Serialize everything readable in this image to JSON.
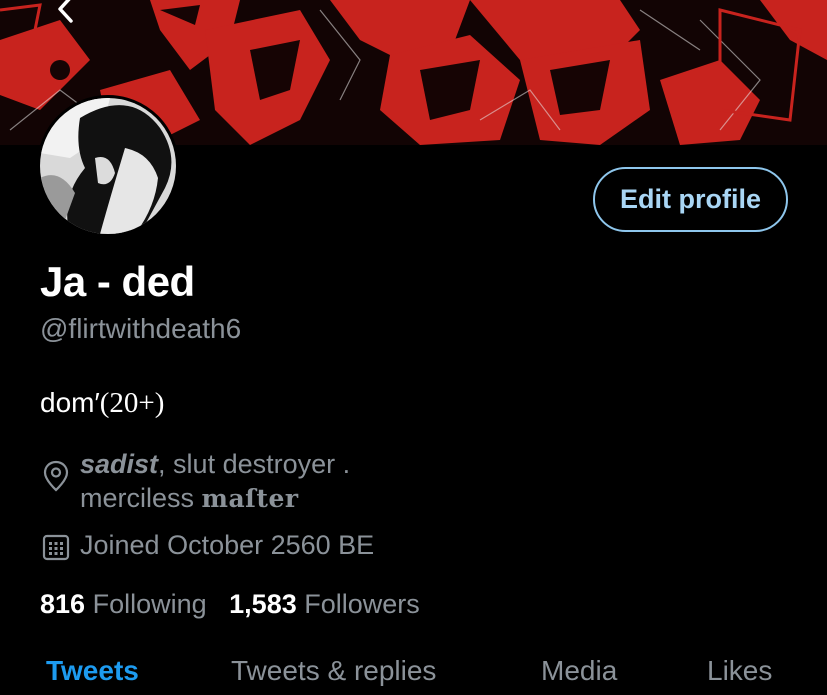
{
  "profile": {
    "name": "Ja - ded",
    "handle": "@flirtwithdeath6",
    "bio_main": "dom′",
    "bio_tail": "(20+)",
    "location": {
      "emphasis": "sadist",
      "line1_rest": ", slut destroyer .",
      "line2_prefix": "merciless ",
      "line2_gothic": "maſter"
    },
    "joined": "Joined October 2560 BE",
    "following_count": "816",
    "following_label": "Following",
    "followers_count": "1,583",
    "followers_label": "Followers"
  },
  "actions": {
    "edit_profile": "Edit profile"
  },
  "tabs": [
    {
      "label": "Tweets",
      "active": true
    },
    {
      "label": "Tweets & replies",
      "active": false
    },
    {
      "label": "Media",
      "active": false
    },
    {
      "label": "Likes",
      "active": false
    }
  ],
  "icons": {
    "back": "chevron-left-icon",
    "location": "location-pin-icon",
    "calendar": "calendar-icon"
  },
  "colors": {
    "background": "#000000",
    "accent": "#1d9bf0",
    "edit_button_border": "#8ec6ec",
    "secondary_text": "#8b9299",
    "banner_red": "#c8231e"
  }
}
